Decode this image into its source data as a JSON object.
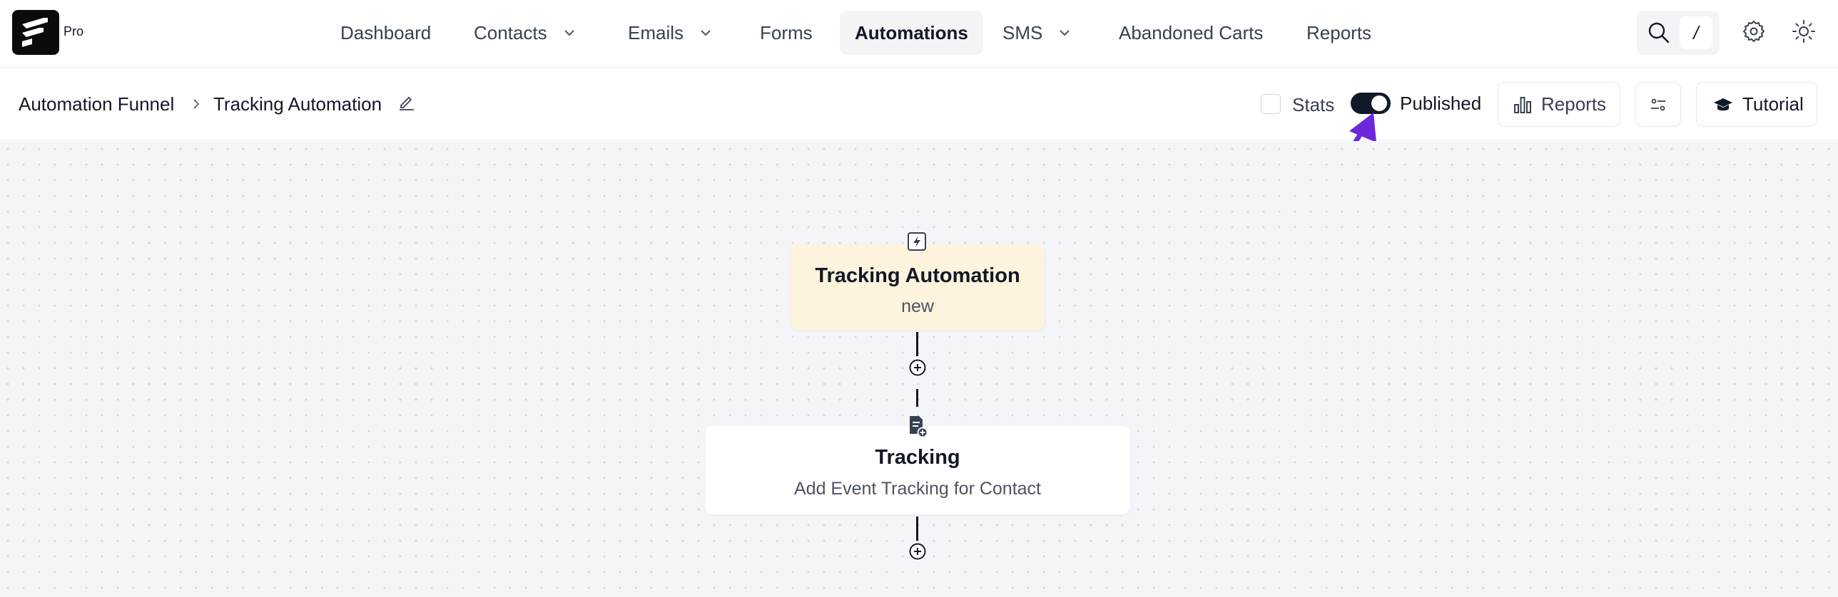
{
  "app": {
    "brand_label": "Pro",
    "logo_icon": "fluent-logo-icon"
  },
  "nav": {
    "items": [
      {
        "label": "Dashboard",
        "has_dropdown": false
      },
      {
        "label": "Contacts",
        "has_dropdown": true
      },
      {
        "label": "Emails",
        "has_dropdown": true
      },
      {
        "label": "Forms",
        "has_dropdown": false
      },
      {
        "label": "Automations",
        "has_dropdown": false,
        "active": true
      },
      {
        "label": "SMS",
        "has_dropdown": true
      },
      {
        "label": "Abandoned Carts",
        "has_dropdown": false
      },
      {
        "label": "Reports",
        "has_dropdown": false
      }
    ],
    "search_shortcut": "/",
    "icons": [
      "search-icon",
      "gear-icon",
      "sun-icon"
    ]
  },
  "header": {
    "breadcrumb_root": "Automation Funnel",
    "breadcrumb_current": "Tracking Automation",
    "stats_label": "Stats",
    "stats_checked": false,
    "published_label": "Published",
    "published_on": true,
    "reports_button": "Reports",
    "tutorial_button": "Tutorial"
  },
  "funnel": {
    "trigger": {
      "title": "Tracking Automation",
      "subtitle": "new",
      "icon": "bolt-icon"
    },
    "action": {
      "title": "Tracking",
      "subtitle": "Add Event Tracking for Contact",
      "icon": "document-add-icon"
    }
  },
  "colors": {
    "trigger_bg": "#fef3dc",
    "active_nav_bg": "#f3f4f6",
    "toggle_on": "#111827",
    "annotation_arrow": "#6d28d9",
    "canvas_bg": "#f4f5f8"
  }
}
